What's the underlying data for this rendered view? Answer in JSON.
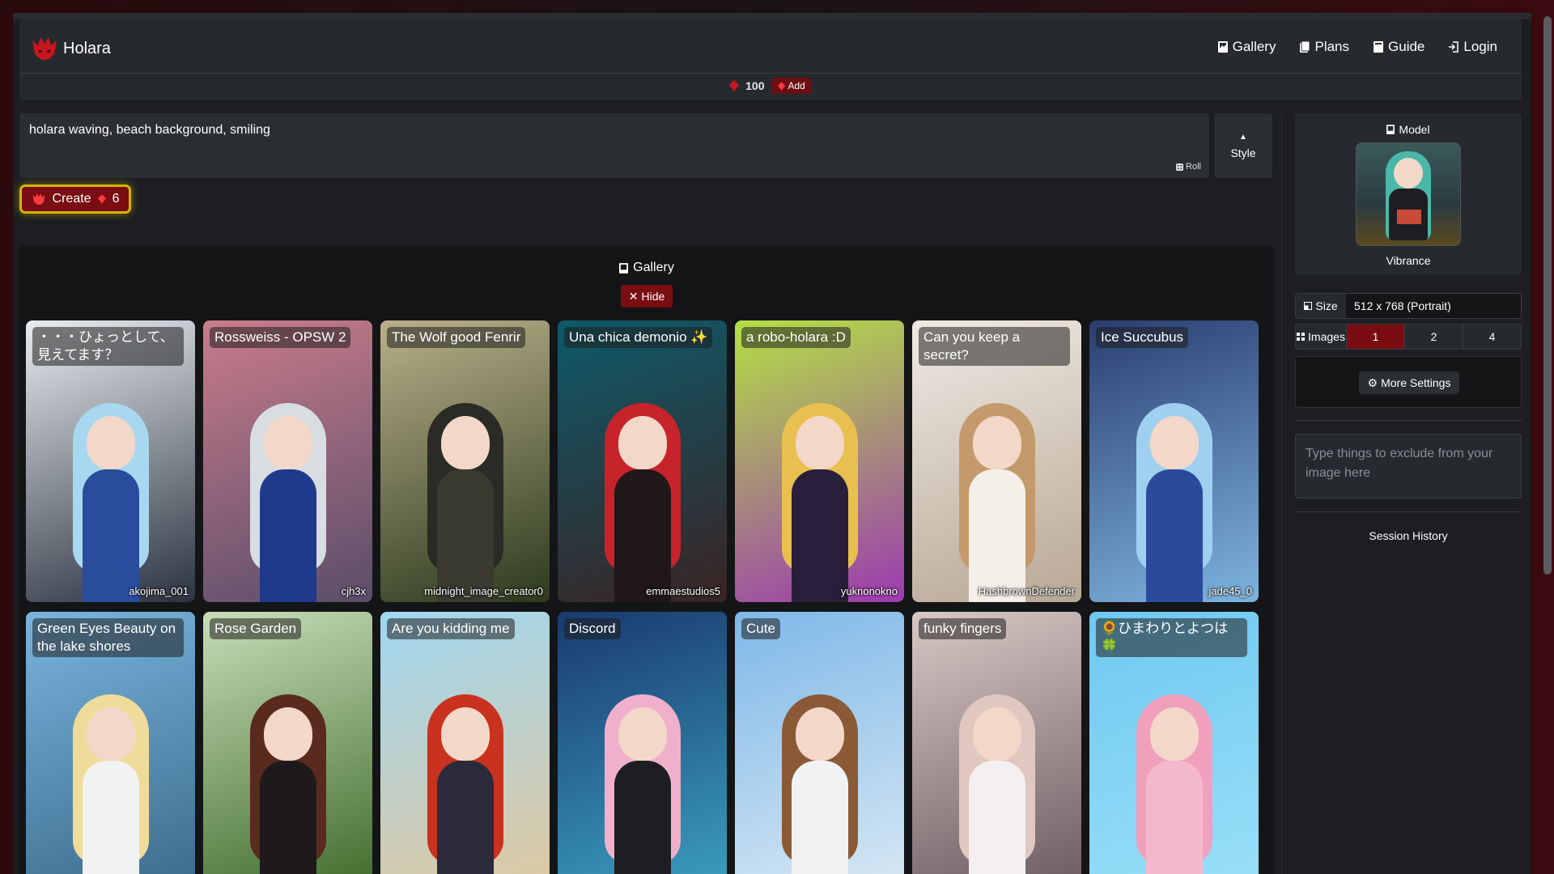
{
  "header": {
    "brand": "Holara",
    "nav": [
      {
        "label": "Gallery",
        "icon": "image-icon"
      },
      {
        "label": "Plans",
        "icon": "clipboard-icon"
      },
      {
        "label": "Guide",
        "icon": "book-icon"
      },
      {
        "label": "Login",
        "icon": "login-icon"
      }
    ],
    "credits": "100",
    "add_label": "Add"
  },
  "prompt": {
    "value": "holara waving, beach background, smiling",
    "roll_label": "Roll",
    "style_label": "Style"
  },
  "create": {
    "label": "Create",
    "cost": "6"
  },
  "gallery": {
    "title": "Gallery",
    "hide_label": "Hide",
    "cards": [
      {
        "title": "・・・ひょっとして、見えてます？",
        "author": "akojima_001",
        "bg": [
          "#e8ecf0",
          "#2b3340"
        ],
        "hair": "#a8d8f0",
        "body": "#2a4c9c"
      },
      {
        "title": "Rossweiss - OPSW 2",
        "author": "cjh3x",
        "bg": [
          "#c97c8a",
          "#5a4d6a"
        ],
        "hair": "#d8dde2",
        "body": "#1f3a8c"
      },
      {
        "title": "The Wolf good Fenrir",
        "author": "midnight_image_creator0",
        "bg": [
          "#b9b08a",
          "#2c3a1e"
        ],
        "hair": "#2b2b26",
        "body": "#3a3a30"
      },
      {
        "title": "Una chica demonio ✨",
        "author": "emmaestudios5",
        "bg": [
          "#0e5a6a",
          "#3a2424"
        ],
        "hair": "#c6242a",
        "body": "#201818"
      },
      {
        "title": "a robo-holara :D",
        "author": "yuknonokno",
        "bg": [
          "#b3e044",
          "#9c3ab0"
        ],
        "hair": "#e8c050",
        "body": "#2a1f3a"
      },
      {
        "title": "Can you keep a secret?",
        "author": "HashbrownDefender",
        "bg": [
          "#efe9e2",
          "#b8a896"
        ],
        "hair": "#c49a6c",
        "body": "#f4efe8"
      },
      {
        "title": "Ice Succubus",
        "author": "jade45_0",
        "bg": [
          "#2a3e70",
          "#7fb4e0"
        ],
        "hair": "#9fd0f0",
        "body": "#2a4a9c"
      },
      {
        "title": "Green Eyes Beauty on the lake shores",
        "author": "",
        "bg": [
          "#7ab4de",
          "#3a6a8a"
        ],
        "hair": "#f0dc9a",
        "body": "#f2f2f2"
      },
      {
        "title": "Rose Garden",
        "author": "",
        "bg": [
          "#c8ddb8",
          "#3e6a2a"
        ],
        "hair": "#5a2a1e",
        "body": "#1e1a1c"
      },
      {
        "title": "Are you kidding me",
        "author": "",
        "bg": [
          "#9fd6f0",
          "#e0c8a0"
        ],
        "hair": "#c8321e",
        "body": "#2a2a3a"
      },
      {
        "title": "Discord",
        "author": "",
        "bg": [
          "#1a3a6e",
          "#3aa0c0"
        ],
        "hair": "#f0b0cc",
        "body": "#1e1e22"
      },
      {
        "title": "Cute",
        "author": "",
        "bg": [
          "#7eb8e8",
          "#d8e8f4"
        ],
        "hair": "#8a5a36",
        "body": "#f2f2f2"
      },
      {
        "title": "funky fingers",
        "author": "",
        "bg": [
          "#d8c8c4",
          "#6a5a60"
        ],
        "hair": "#e0c8c0",
        "body": "#f4f0f2"
      },
      {
        "title": "🌻ひまわりとよつは🍀",
        "author": "",
        "bg": [
          "#6ec8f0",
          "#9ae0f8"
        ],
        "hair": "#f0a0bc",
        "body": "#f4b8cc"
      }
    ]
  },
  "sidebar": {
    "model_title": "Model",
    "model_name": "Vibrance",
    "size_label": "Size",
    "size_value": "512 x 768 (Portrait)",
    "images_label": "Images",
    "images_options": [
      "1",
      "2",
      "4"
    ],
    "images_selected": "1",
    "more_settings": "More Settings",
    "negative_placeholder": "Type things to exclude from your image here",
    "session_history": "Session History"
  },
  "colors": {
    "accent": "#7a0d12",
    "highlight": "#d4b300",
    "surface": "#26292d"
  }
}
